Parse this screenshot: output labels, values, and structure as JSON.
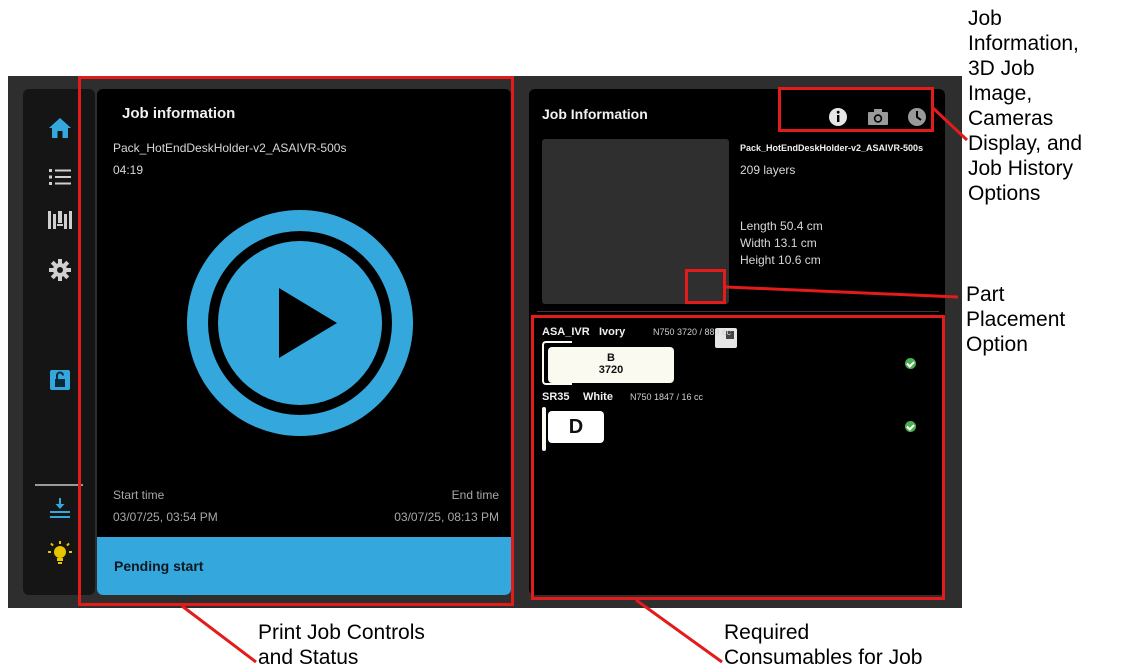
{
  "colors": {
    "accent": "#34a8dc",
    "callout": "#e31b1b",
    "panel": "#000000",
    "screen": "#2e2e2e"
  },
  "sidebar": {
    "items": [
      {
        "icon": "home-icon"
      },
      {
        "icon": "list-icon"
      },
      {
        "icon": "materials-icon"
      },
      {
        "icon": "gear-icon"
      },
      {
        "icon": "unlock-icon"
      },
      {
        "icon": "download-tray-icon"
      },
      {
        "icon": "light-bulb-icon"
      }
    ]
  },
  "left_panel": {
    "title": "Job information",
    "job_name": "Pack_HotEndDeskHolder-v2_ASAIVR-500s",
    "duration": "04:19",
    "play_icon": "play-button-icon",
    "start_label": "Start time",
    "start_value": "03/07/25, 03:54 PM",
    "end_label": "End time",
    "end_value": "03/07/25, 08:13 PM",
    "status": "Pending start"
  },
  "right_panel": {
    "title": "Job Information",
    "header_icons": [
      "info-icon",
      "camera-icon",
      "clock-icon"
    ],
    "job_name": "Pack_HotEndDeskHolder-v2_ASAIVR-500s",
    "layers": "209 layers",
    "length": "Length 50.4 cm",
    "width": "Width 13.1 cm",
    "height": "Height 10.6 cm",
    "consumables": [
      {
        "material": "ASA_IVR",
        "color": "Ivory",
        "detail": "N750 3720 / 889 cc",
        "slot": "B",
        "code": "3720"
      },
      {
        "material": "SR35",
        "color": "White",
        "detail": "N750 1847 / 16 cc",
        "slot": "D"
      }
    ]
  },
  "annotations": {
    "print_controls": "Print Job Controls\nand Status",
    "consumables": "Required\nConsumables for Job",
    "part_placement": "Part\nPlacement\nOption",
    "header_options": "Job\nInformation,\n3D Job\nImage,\nCameras\nDisplay, and\nJob History\nOptions"
  }
}
